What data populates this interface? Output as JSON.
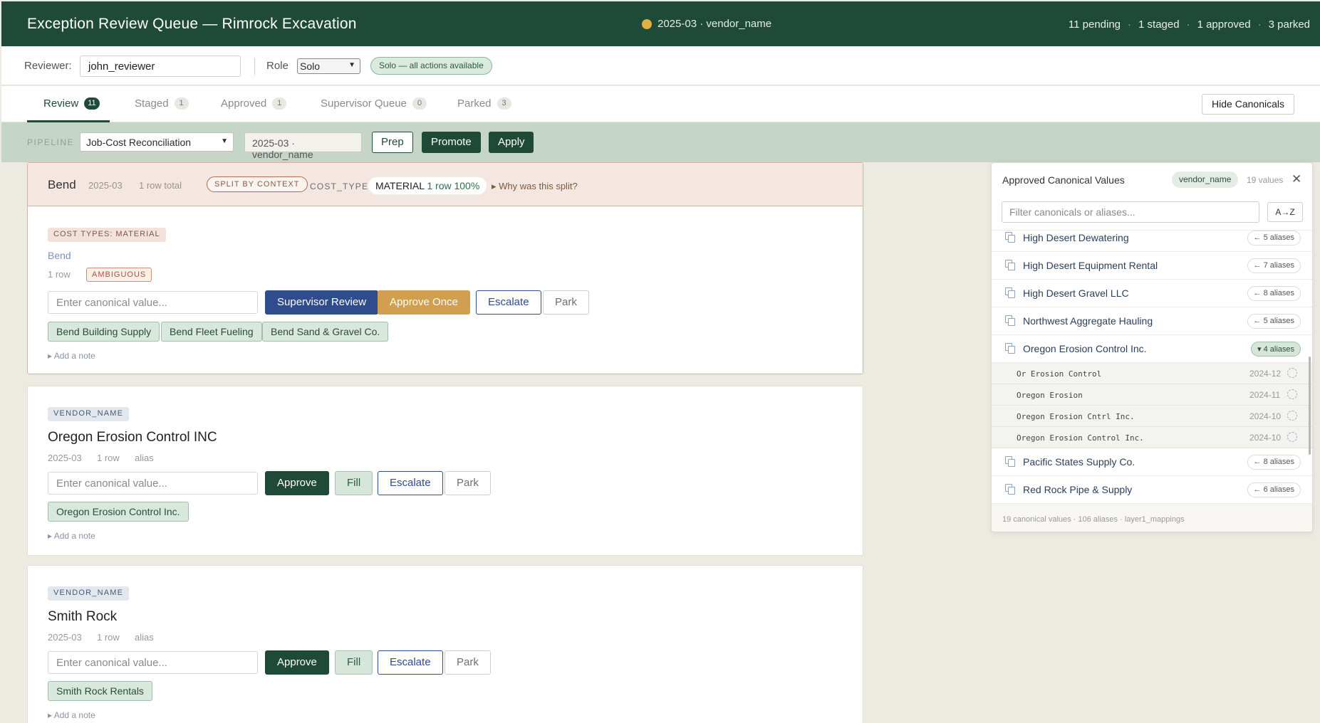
{
  "header": {
    "title": "Exception Review Queue — Rimrock Excavation",
    "context": "2025-03 · vendor_name",
    "stats": [
      "11 pending",
      "1 staged",
      "1 approved",
      "3 parked"
    ],
    "dot_color": "#e0b043"
  },
  "reviewer": {
    "label": "Reviewer:",
    "value": "john_reviewer",
    "role_label": "Role",
    "role_value": "Solo",
    "role_badge": "Solo — all actions available"
  },
  "tabs": [
    {
      "label": "Review",
      "count": "11"
    },
    {
      "label": "Staged",
      "count": "1"
    },
    {
      "label": "Approved",
      "count": "1"
    },
    {
      "label": "Supervisor Queue",
      "count": "0"
    },
    {
      "label": "Parked",
      "count": "3"
    }
  ],
  "hide_canonicals_label": "Hide Canonicals",
  "pipeline": {
    "label": "PIPELINE",
    "selected": "Job-Cost Reconciliation",
    "field": "2025-03 · vendor_name",
    "prep": "Prep",
    "promote": "Promote",
    "apply": "Apply"
  },
  "split_card": {
    "location": "Bend",
    "period": "2025-03",
    "rows_total": "1 row total",
    "split_badge": "SPLIT BY CONTEXT",
    "cost_type_label": "COST_TYPE:",
    "cost_type_value": "MATERIAL",
    "cost_type_sub": "1 row 100%",
    "why": "▸ Why was this split?",
    "group_chip": "COST TYPES: MATERIAL",
    "group_name": "Bend",
    "group_rows": "1 row",
    "ambiguous": "AMBIGUOUS",
    "input_placeholder": "Enter canonical value...",
    "supervisor_review": "Supervisor Review",
    "approve_once": "Approve Once",
    "escalate": "Escalate",
    "park": "Park",
    "suggestions": [
      "Bend Building Supply",
      "Bend Fleet Fueling",
      "Bend Sand & Gravel Co."
    ],
    "add_note": "▸ Add a note"
  },
  "cards": [
    {
      "field_chip": "VENDOR_NAME",
      "value": "Oregon Erosion Control INC",
      "period": "2025-03",
      "rows": "1 row",
      "kind": "alias",
      "input_placeholder": "Enter canonical value...",
      "approve": "Approve",
      "fill": "Fill",
      "escalate": "Escalate",
      "park": "Park",
      "suggestion": "Oregon Erosion Control Inc.",
      "add_note": "▸ Add a note"
    },
    {
      "field_chip": "VENDOR_NAME",
      "value": "Smith Rock",
      "period": "2025-03",
      "rows": "1 row",
      "kind": "alias",
      "input_placeholder": "Enter canonical value...",
      "approve": "Approve",
      "fill": "Fill",
      "escalate": "Escalate",
      "park": "Park",
      "suggestion": "Smith Rock Rentals",
      "add_note": "▸ Add a note"
    }
  ],
  "canonicals": {
    "title": "Approved Canonical Values",
    "field": "vendor_name",
    "count": "19 values",
    "filter_placeholder": "Filter canonicals or aliases...",
    "sort": "A→Z",
    "items": [
      {
        "name": "High Desert Dewatering",
        "aliases": "← 5 aliases"
      },
      {
        "name": "High Desert Equipment Rental",
        "aliases": "← 7 aliases"
      },
      {
        "name": "High Desert Gravel LLC",
        "aliases": "← 8 aliases"
      },
      {
        "name": "Northwest Aggregate Hauling",
        "aliases": "← 5 aliases"
      },
      {
        "name": "Oregon Erosion Control Inc.",
        "aliases": "▾ 4 aliases"
      },
      {
        "name": "Pacific States Supply Co.",
        "aliases": "← 8 aliases"
      },
      {
        "name": "Red Rock Pipe & Supply",
        "aliases": "← 6 aliases"
      }
    ],
    "expanded_aliases": [
      {
        "alias": "Or Erosion Control",
        "date": "2024-12"
      },
      {
        "alias": "Oregon Erosion",
        "date": "2024-11"
      },
      {
        "alias": "Oregon Erosion Cntrl Inc.",
        "date": "2024-10"
      },
      {
        "alias": "Oregon Erosion Control Inc.",
        "date": "2024-10"
      }
    ],
    "footer": "19 canonical values · 106 aliases · layer1_mappings"
  }
}
